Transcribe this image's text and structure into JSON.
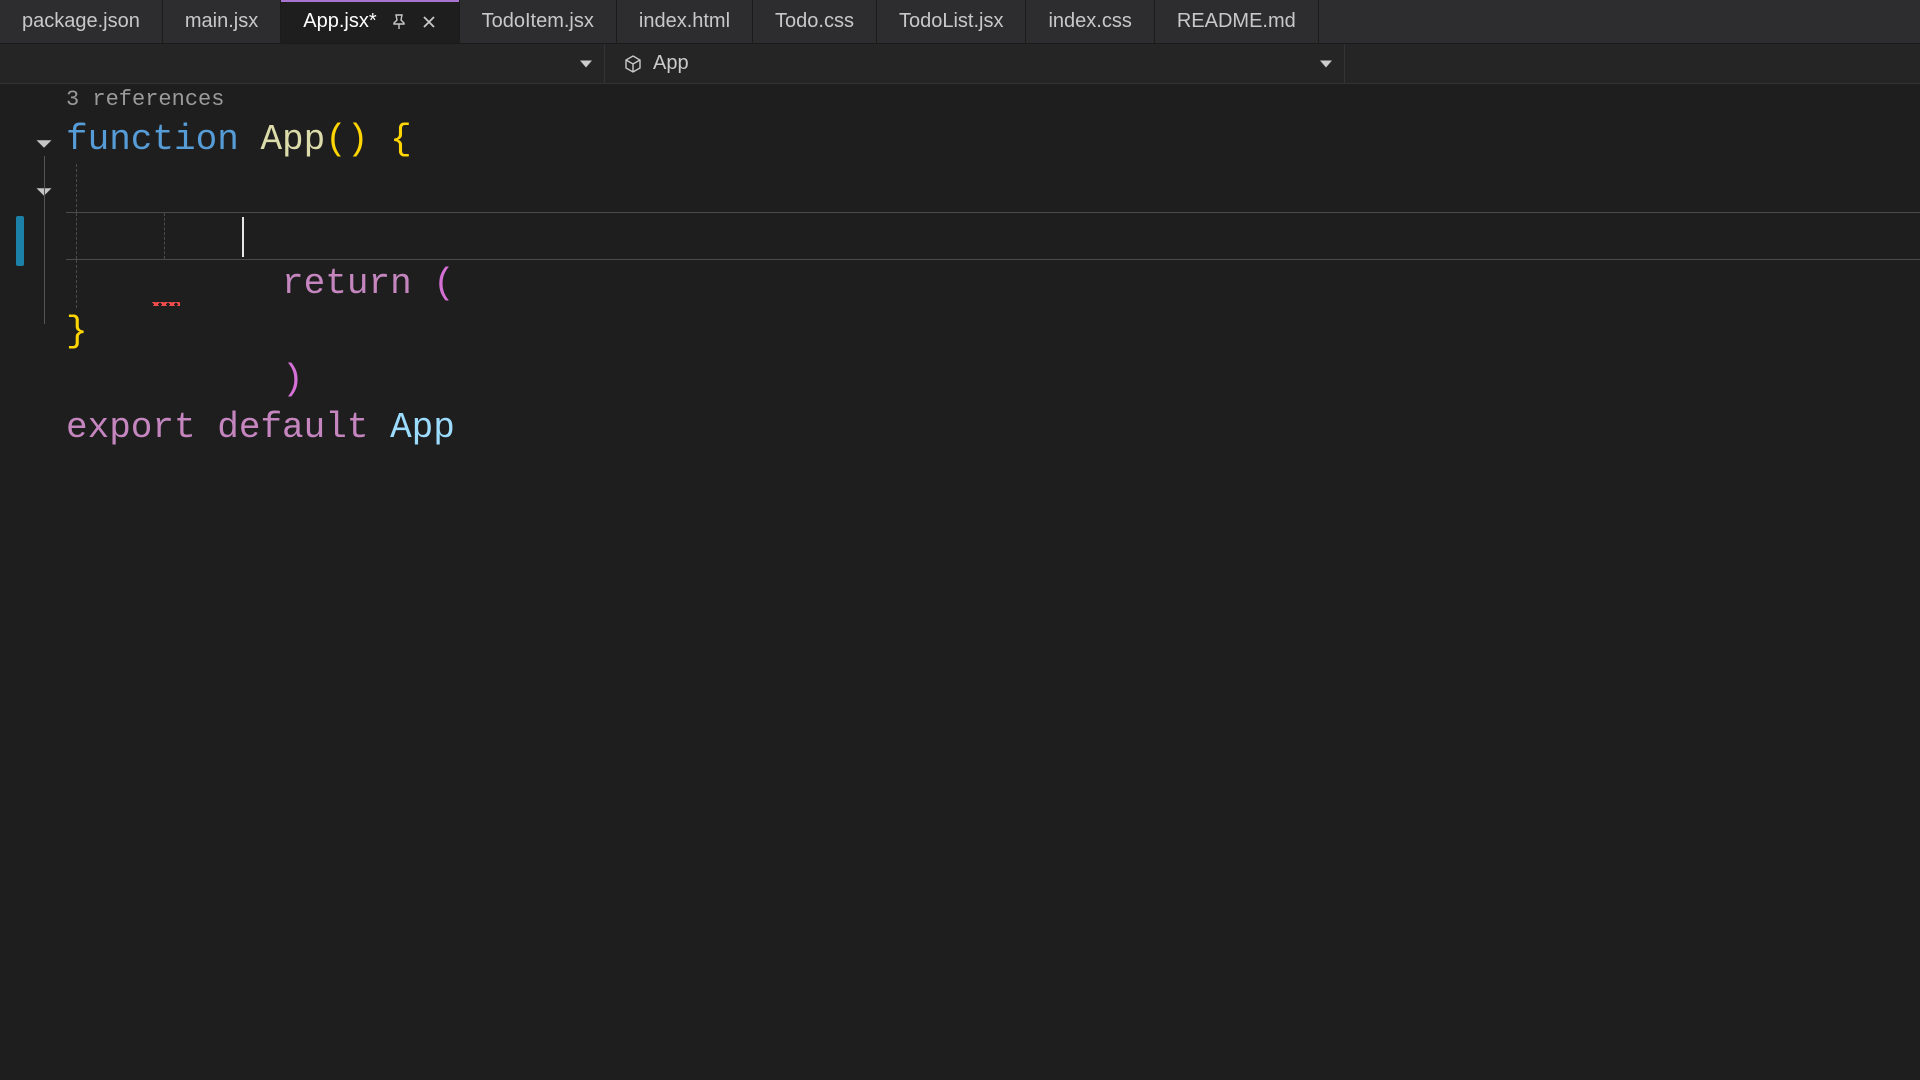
{
  "tabs": [
    {
      "label": "package.json",
      "active": false
    },
    {
      "label": "main.jsx",
      "active": false
    },
    {
      "label": "App.jsx*",
      "active": true,
      "pinned": true,
      "closable": true
    },
    {
      "label": "TodoItem.jsx",
      "active": false
    },
    {
      "label": "index.html",
      "active": false
    },
    {
      "label": "Todo.css",
      "active": false
    },
    {
      "label": "TodoList.jsx",
      "active": false
    },
    {
      "label": "index.css",
      "active": false
    },
    {
      "label": "README.md",
      "active": false
    }
  ],
  "scope": {
    "left_label": "",
    "right_label": "App"
  },
  "codelens": {
    "references": "3 references"
  },
  "code": {
    "l1": {
      "kw": "function",
      "sp1": " ",
      "fn": "App",
      "py_open": "(",
      "py_close": ")",
      "sp2": " ",
      "brace_open": "{"
    },
    "l2": {
      "indent": "    ",
      "kw": "return",
      "sp": " ",
      "pp_open": "("
    },
    "l3": {
      "indent": "        "
    },
    "l4": {
      "indent": "    ",
      "pp_close": ")"
    },
    "l5": {
      "brace_close": "}"
    },
    "blank": "",
    "l7": {
      "kw1": "export",
      "sp1": " ",
      "kw2": "default",
      "sp2": " ",
      "ident": "App"
    }
  }
}
